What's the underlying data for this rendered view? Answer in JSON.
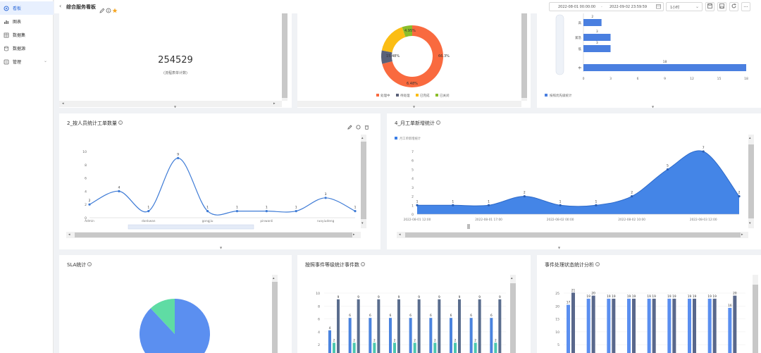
{
  "sidebar": {
    "items": [
      {
        "label": "看板",
        "icon": "dashboard-icon",
        "active": true
      },
      {
        "label": "图表",
        "icon": "chart-icon"
      },
      {
        "label": "数据集",
        "icon": "dataset-icon"
      },
      {
        "label": "数据源",
        "icon": "datasource-icon"
      },
      {
        "label": "管理",
        "icon": "manage-icon"
      }
    ]
  },
  "header": {
    "title": "综合服务看板",
    "date_start": "2022-08-01 00:00:00",
    "date_end": "2022-09-02 23:59:59",
    "quick_range": "1小时"
  },
  "panels": {
    "total": {
      "value": "254529",
      "caption": "(流程表单计数)"
    },
    "donut": {
      "labels": [
        "15.48%",
        "6.48%",
        "66.3%",
        "4.95%"
      ],
      "legend": [
        "处理中",
        "待处理",
        "已完成",
        "已关闭"
      ]
    },
    "hbar": {
      "legend": "按照优先级统计"
    },
    "people": {
      "title": "2_按人员统计工单数量"
    },
    "monthly": {
      "title": "4_月工单新增统计",
      "legend": "月工单新增统计"
    },
    "sla": {
      "title": "SLA统计"
    },
    "event_level": {
      "title": "按照事件等级统计事件数"
    },
    "event_status": {
      "title": "事件处理状态统计分析"
    }
  },
  "chart_data": [
    {
      "type": "pie",
      "categories": [
        "处理中",
        "待处理",
        "已完成",
        "已关闭"
      ],
      "values": [
        66.3,
        6.48,
        15.48,
        4.95
      ],
      "colors": [
        "#f96a3f",
        "#5a6179",
        "#fbbd14",
        "#8bbd2a"
      ],
      "donut": true,
      "legend_position": "bottom"
    },
    {
      "type": "bar",
      "orientation": "horizontal",
      "categories": [
        "中",
        "低",
        "紧急",
        "高"
      ],
      "values": [
        18,
        3,
        3,
        2
      ],
      "xticks": [
        "0",
        "3",
        "6",
        "9",
        "12",
        "15",
        "18"
      ],
      "xlim": [
        0,
        18
      ],
      "color": "#4a7fe0",
      "legend_position": "bottom-left"
    },
    {
      "type": "line",
      "categories": [
        "Admin",
        "",
        "donkwan",
        "",
        "gongjiu",
        "",
        "pinwanli",
        "",
        "ruoyiudeng",
        ""
      ],
      "values": [
        2,
        4,
        1,
        9,
        1,
        1,
        1,
        1,
        3,
        1
      ],
      "yticks": [
        "10",
        "8",
        "6",
        "4",
        "2",
        "0"
      ],
      "ylim": [
        0,
        10
      ],
      "smooth": true,
      "color": "#3e7bd6"
    },
    {
      "type": "area",
      "x": [
        "2022-08-01 12:00",
        "",
        "2022-08-01 17:00",
        "",
        "2022-08-02 00:00",
        "",
        "2022-08-02 10:00",
        "",
        "2022-08-03 12:00",
        ""
      ],
      "values": [
        1,
        1,
        1,
        2,
        1,
        1,
        2,
        5,
        7,
        2
      ],
      "yticks": [
        "7",
        "6",
        "5",
        "4",
        "3",
        "2",
        "1",
        "0"
      ],
      "ylim": [
        0,
        7
      ],
      "smooth": true,
      "color": "#3a7ee6"
    },
    {
      "type": "pie",
      "values": [
        88,
        12
      ],
      "colors": [
        "#5b8ff0",
        "#5fdca4"
      ]
    },
    {
      "type": "bar",
      "yticks": [
        "10",
        "8",
        "6",
        "4",
        "2"
      ],
      "ylim": [
        0,
        10
      ],
      "series": [
        {
          "values": [
            4,
            6,
            6,
            6,
            6,
            6,
            6,
            6,
            6
          ],
          "color": "#4a83df"
        },
        {
          "values": [
            2,
            2,
            2,
            2,
            2,
            2,
            2,
            2,
            2
          ],
          "color": "#4bc7b0"
        },
        {
          "values": [
            9,
            9,
            9,
            9,
            9,
            9,
            9,
            9,
            9
          ],
          "color": "#5a6d8e"
        }
      ]
    },
    {
      "type": "bar",
      "yticks": [
        "25",
        "20",
        "15",
        "10",
        "5"
      ],
      "ylim": [
        0,
        25
      ],
      "series": [
        {
          "values": [
            17,
            19,
            19,
            19,
            19,
            19,
            19,
            19,
            16
          ],
          "color": "#5b8ff0"
        },
        {
          "values": [
            21,
            20,
            19,
            19,
            19,
            19,
            19,
            19,
            20
          ],
          "color": "#59688c"
        }
      ]
    }
  ]
}
